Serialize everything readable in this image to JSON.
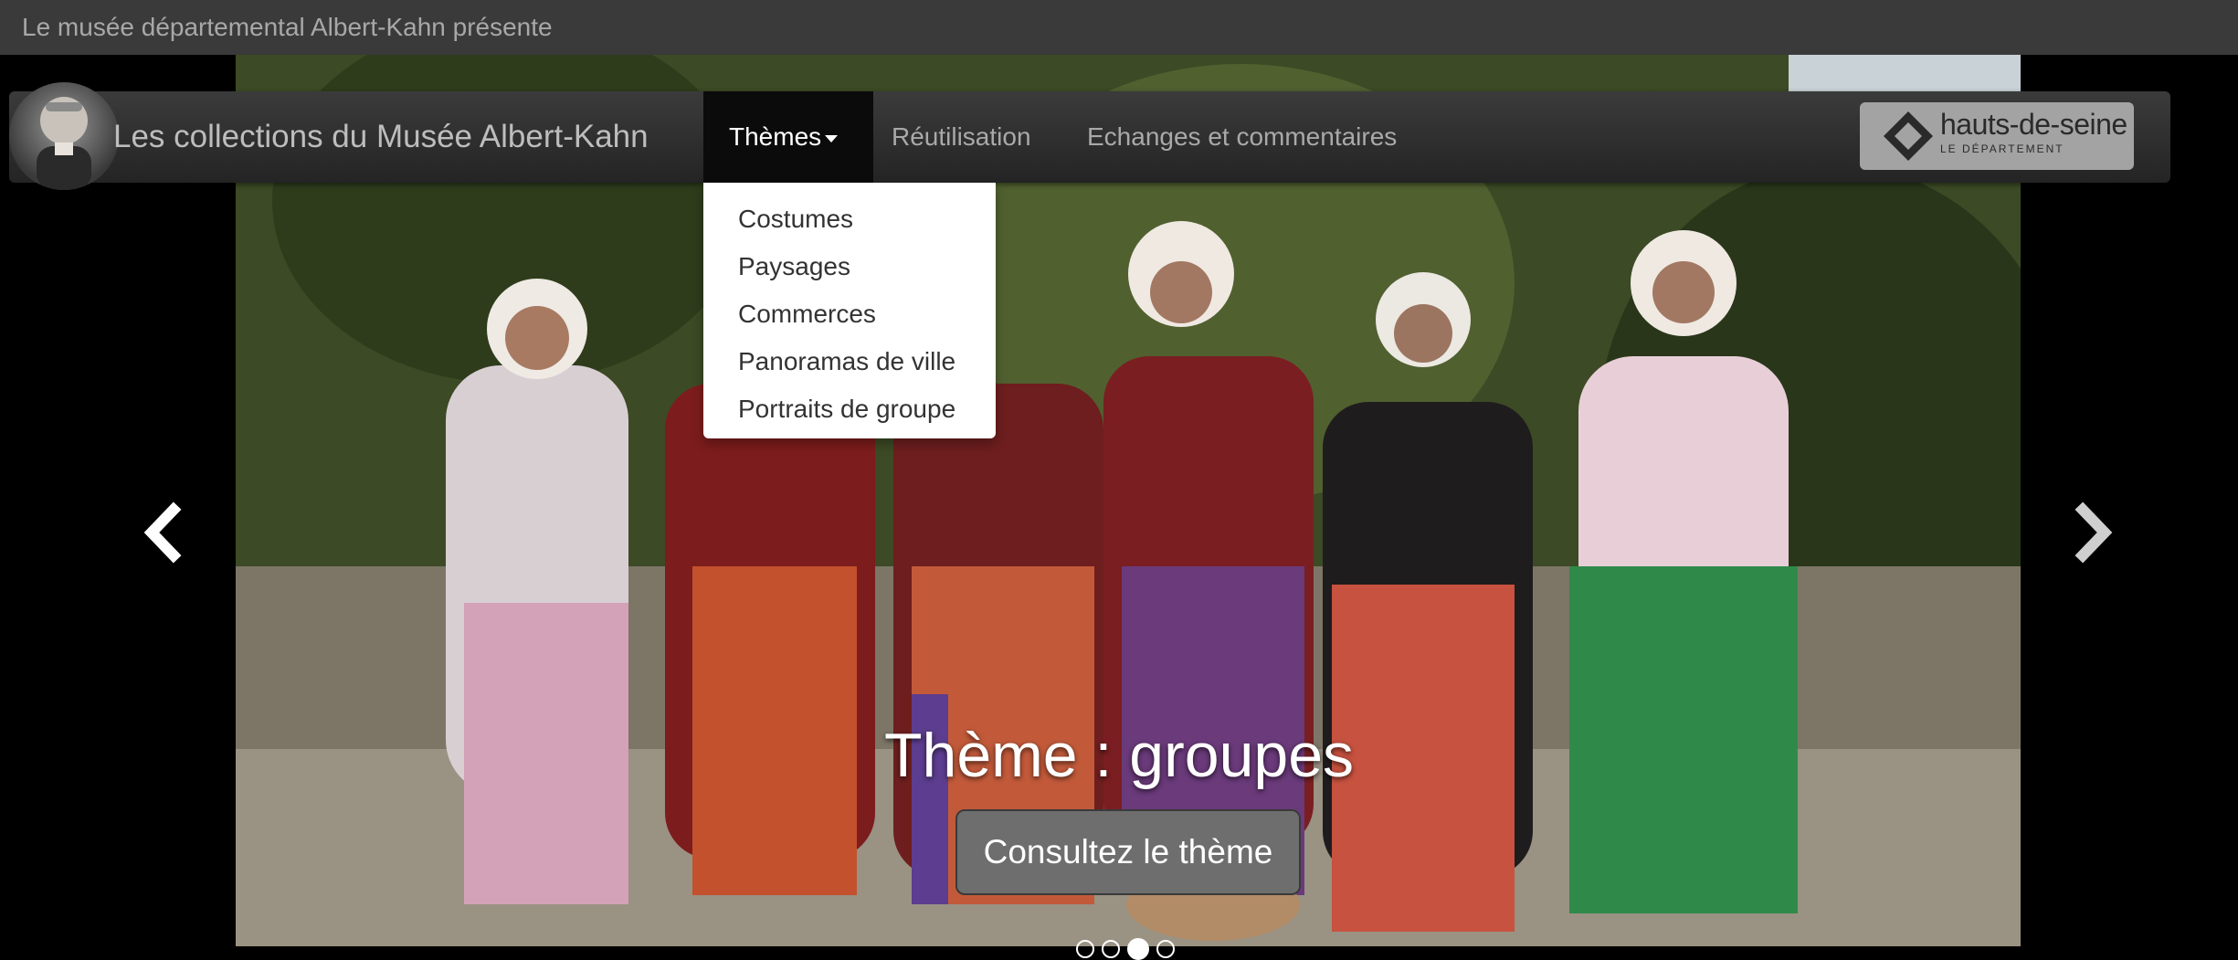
{
  "banner": {
    "text": "Le musée départemental Albert-Kahn présente"
  },
  "navbar": {
    "brand": "Les collections du Musée Albert-Kahn",
    "items": [
      {
        "label": "Thèmes",
        "active": true,
        "has_caret": true
      },
      {
        "label": "Réutilisation",
        "active": false
      },
      {
        "label": "Echanges et commentaires",
        "active": false
      }
    ],
    "logo": {
      "text": "hauts-de-seine",
      "sub": "LE DÉPARTEMENT"
    }
  },
  "dropdown": {
    "items": [
      "Costumes",
      "Paysages",
      "Commerces",
      "Panoramas de ville",
      "Portraits de groupe"
    ]
  },
  "carousel": {
    "caption": "Thème : groupes",
    "button": "Consultez le thème",
    "indicators": {
      "count": 4,
      "active_index": 2
    },
    "prev_icon": "chevron-left-icon",
    "next_icon": "chevron-right-icon"
  },
  "colors": {
    "topstrip": "#3a3a3a",
    "navbar": "#2f2f2f",
    "active_nav": "#0b0b0b",
    "button": "#6e6e6e"
  }
}
